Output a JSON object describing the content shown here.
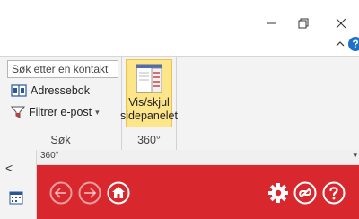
{
  "window": {
    "minimize_icon": "minimize-icon",
    "restore_icon": "restore-icon",
    "close_icon": "close-icon",
    "collapse_ribbon_icon": "chevron-up-icon",
    "help_label": "?"
  },
  "ribbon": {
    "sok_group": {
      "search_placeholder": "Søk etter en kontakt",
      "address_book_label": "Adressebok",
      "filter_email_label": "Filtrer e-post",
      "filter_dropdown": "▾",
      "label": "Søk"
    },
    "group_360": {
      "toggle_sidepanel_line1": "Vis/skjul",
      "toggle_sidepanel_line2": "sidepanelet",
      "label": "360°"
    }
  },
  "sidebar": {
    "expand_label": "<"
  },
  "panel": {
    "title": "360°",
    "dropdown": "▾",
    "icons": [
      "back-icon",
      "forward-icon",
      "home-icon",
      "settings-icon",
      "link-icon",
      "help-icon"
    ]
  },
  "colors": {
    "accent_red": "#d9272e",
    "highlight": "#fde58a",
    "help_blue": "#1e70c8"
  }
}
